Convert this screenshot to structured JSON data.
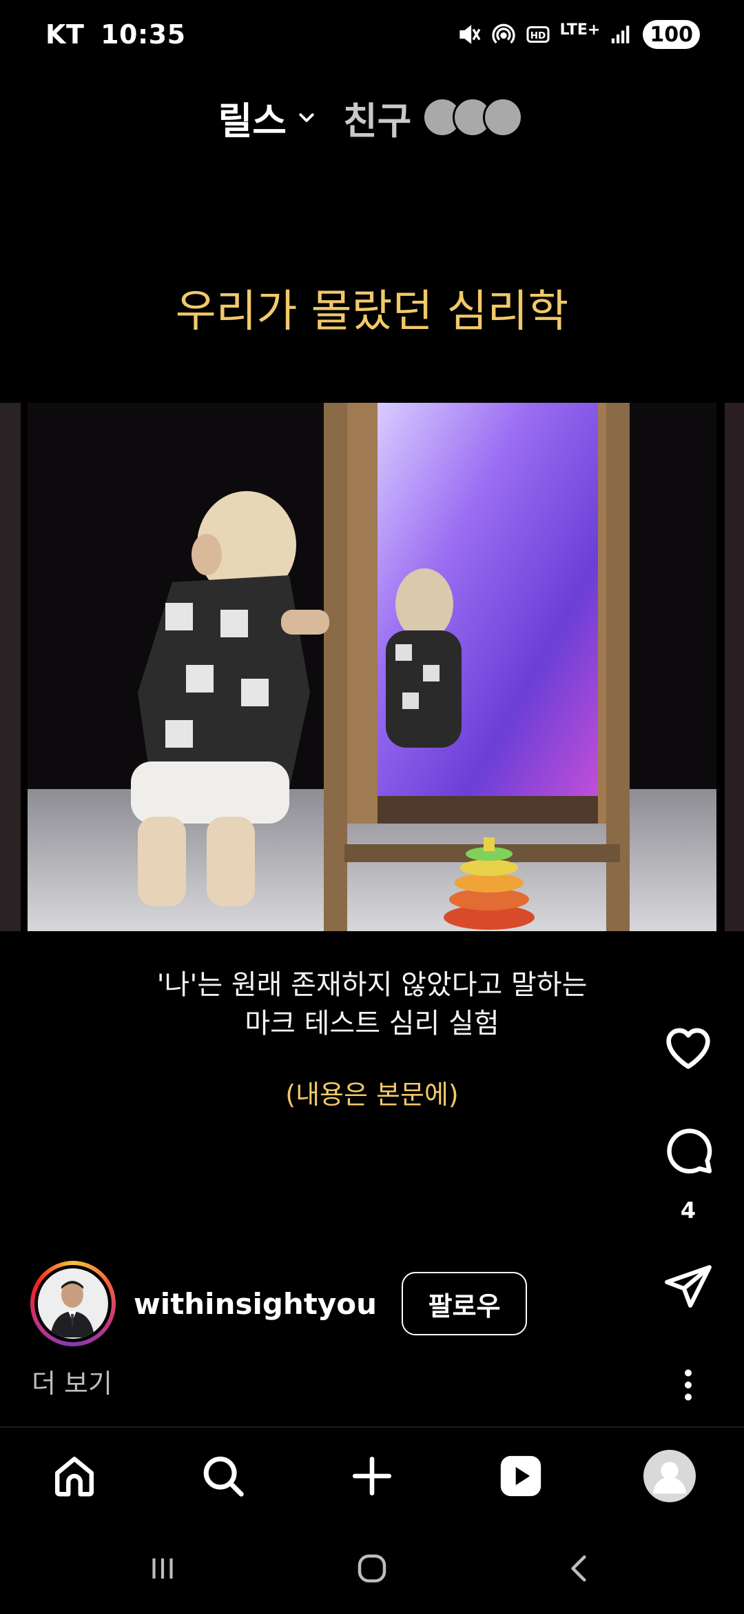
{
  "status": {
    "carrier": "KT",
    "time": "10:35",
    "network": "LTE+",
    "battery": "100"
  },
  "top_nav": {
    "reels_label": "릴스",
    "friends_label": "친구"
  },
  "reel": {
    "title": "우리가 몰랐던 심리학",
    "caption_line1": "'나'는 원래 존재하지 않았다고 말하는",
    "caption_line2": "마크 테스트 심리 실험",
    "caption_note": "(내용은 본문에)",
    "comment_count": "4",
    "username": "withinsightyou",
    "follow_label": "팔로우",
    "more_label": "더 보기"
  },
  "icons": {
    "reels_dropdown": "chevron-down-icon",
    "like": "heart-icon",
    "comment": "comment-icon",
    "share": "send-icon",
    "more": "more-vertical-icon",
    "home": "home-icon",
    "search": "search-icon",
    "create": "plus-icon",
    "reels": "reels-icon",
    "profile": "profile-avatar",
    "sys_recent": "recent-apps-icon",
    "sys_home": "home-button-icon",
    "sys_back": "back-icon"
  },
  "colors": {
    "title_accent": "#f1c96a",
    "background": "#000000"
  }
}
